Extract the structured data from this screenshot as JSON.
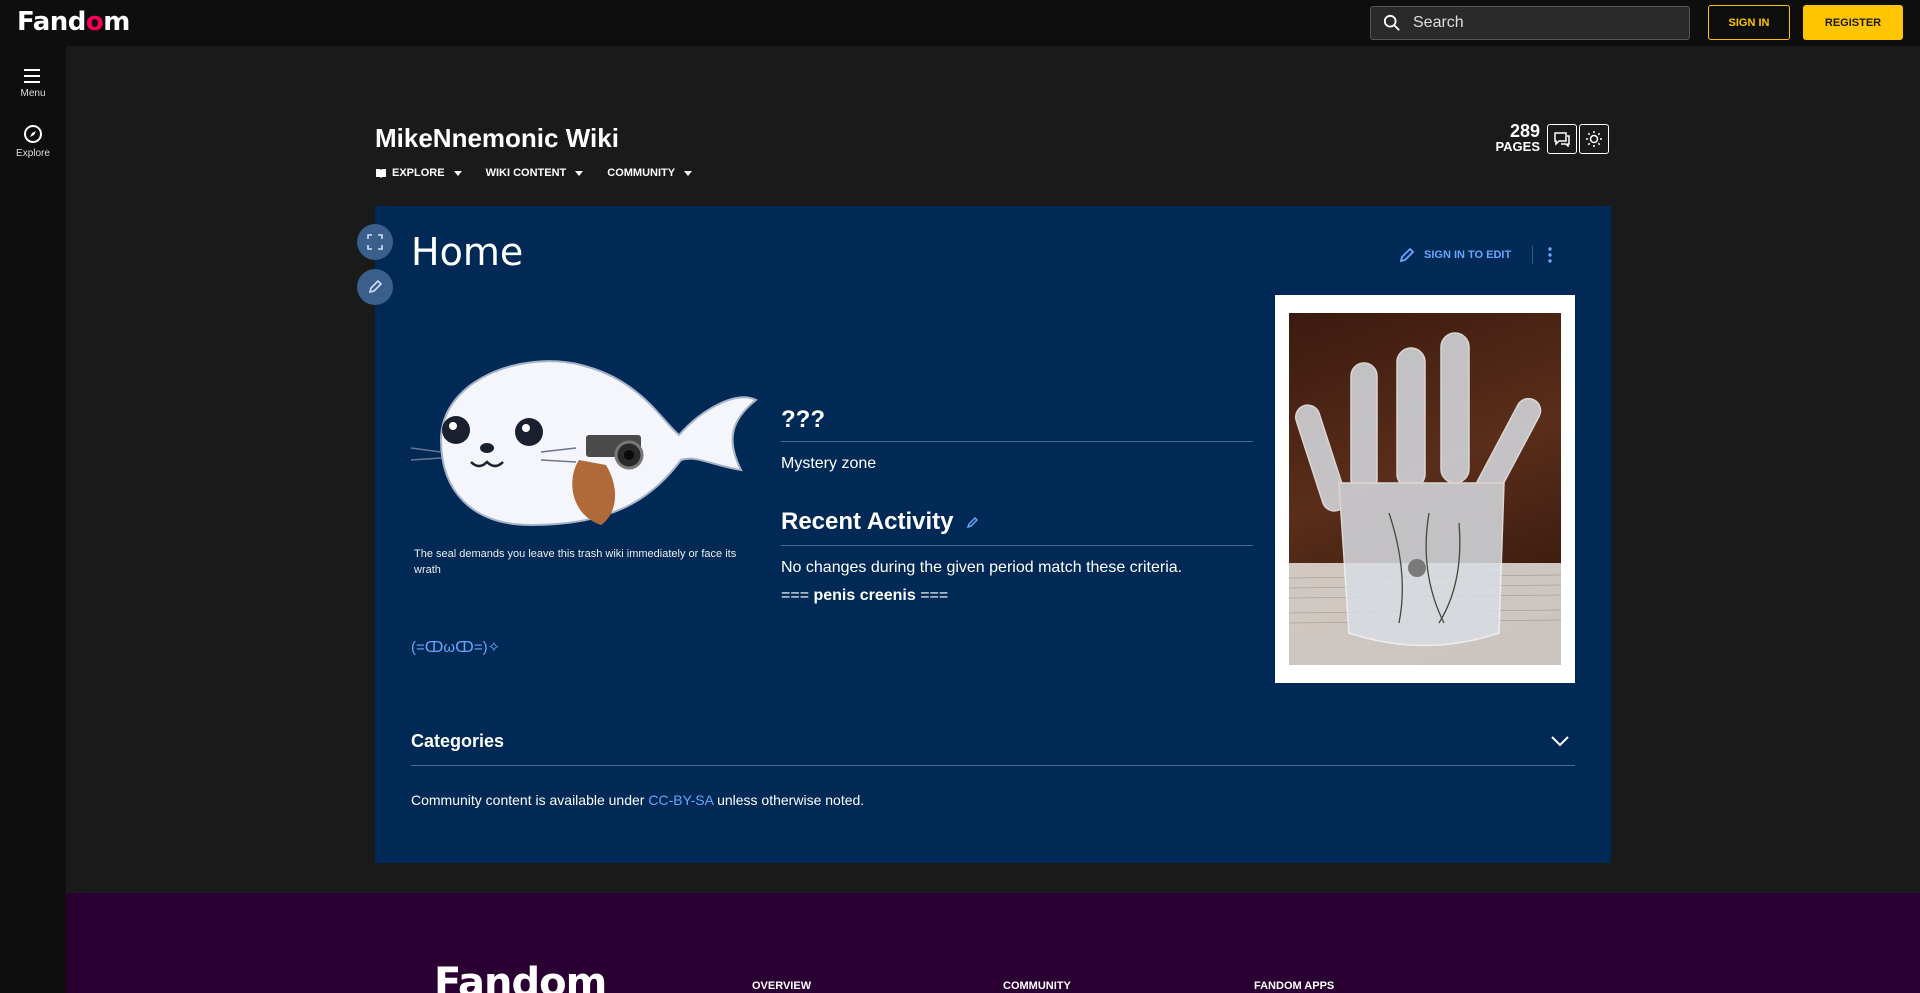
{
  "global_nav": {
    "logo_text_a": "Fand",
    "logo_text_o": "o",
    "logo_text_b": "m",
    "search_placeholder": "Search",
    "sign_in": "SIGN IN",
    "register": "REGISTER"
  },
  "left_rail": {
    "menu": "Menu",
    "explore": "Explore"
  },
  "wiki": {
    "title": "MikeNnemonic Wiki",
    "nav": [
      {
        "label": "EXPLORE"
      },
      {
        "label": "WIKI CONTENT"
      },
      {
        "label": "COMMUNITY"
      }
    ],
    "page_count": "289",
    "page_count_label": "PAGES"
  },
  "article": {
    "title": "Home",
    "sign_in_to_edit": "SIGN IN TO EDIT",
    "seal_caption": "The seal demands you leave this trash wiki immediately or face its wrath",
    "emoticon": "(=ↀωↀ=)✧",
    "section1_heading": "???",
    "section1_text": "Mystery zone",
    "section2_heading": "Recent Activity",
    "section2_text": "No changes during the given period match these criteria.",
    "section3_prefix": "=== ",
    "section3_bold": "penis creenis",
    "section3_suffix": " ===",
    "categories": "Categories",
    "license_prefix": "Community content is available under ",
    "license_link": "CC-BY-SA",
    "license_suffix": " unless otherwise noted."
  },
  "footer": {
    "logo": "Fandom",
    "col1": "OVERVIEW",
    "col2": "COMMUNITY",
    "col3": "FANDOM APPS"
  },
  "colors": {
    "accent": "#ffc500",
    "brand_pink": "#fa005a",
    "link": "#69a5ff",
    "article_bg": "#002a55",
    "footer_bg": "#2a0033"
  }
}
